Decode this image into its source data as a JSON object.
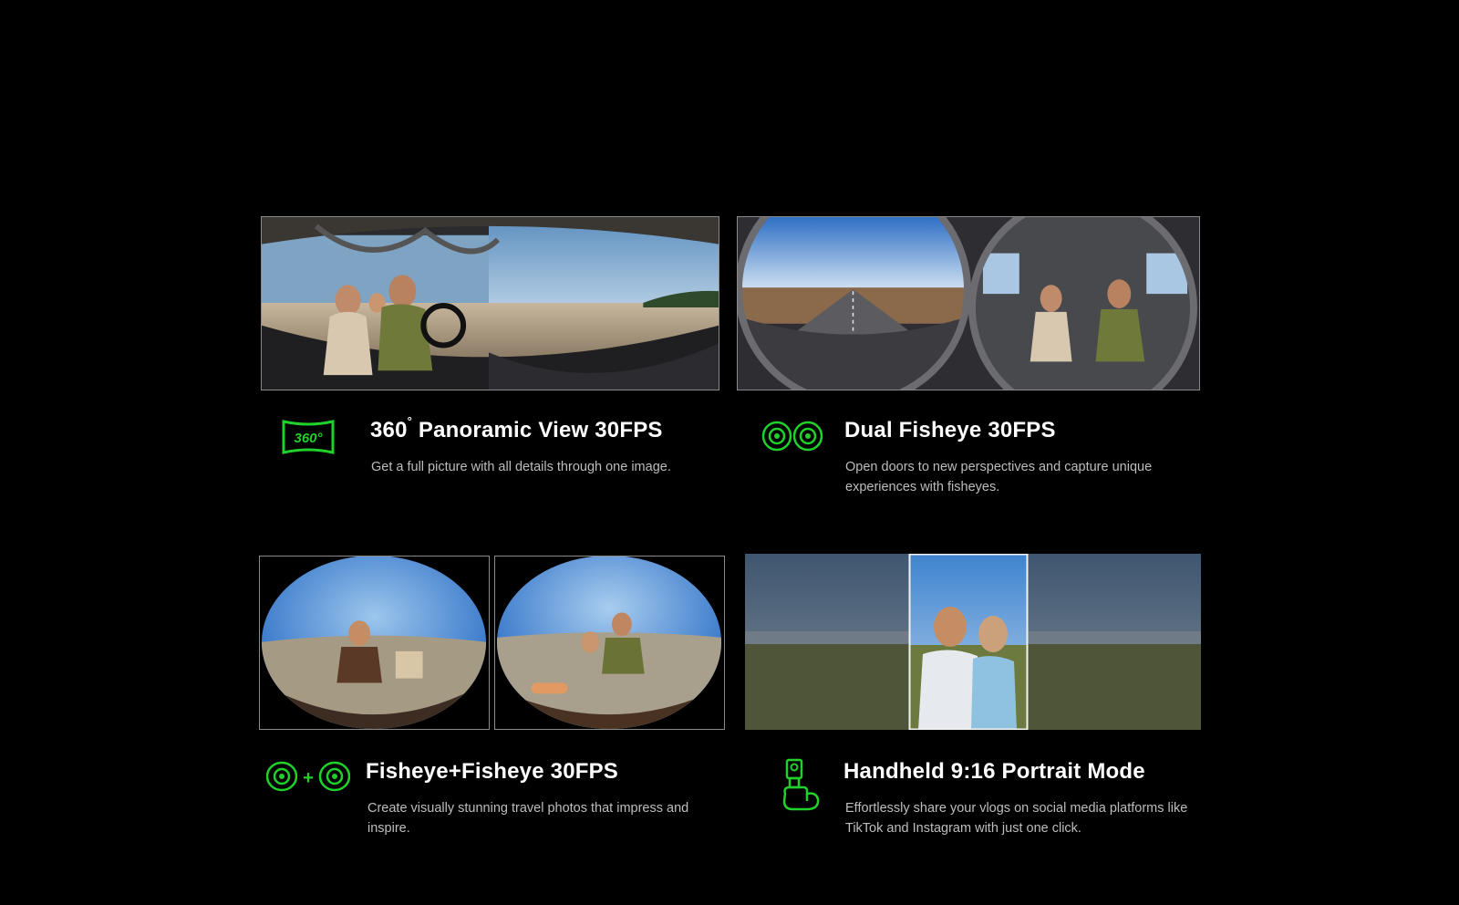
{
  "features": [
    {
      "id": "panoramic",
      "title_main": "360",
      "title_degree": "°",
      "title_rest": " Panoramic View 30FPS",
      "description": "Get a full picture with all details through one image.",
      "icon": "360-badge-icon",
      "icon_text": "360°"
    },
    {
      "id": "dual-fisheye",
      "title": "Dual Fisheye 30FPS",
      "description": "Open doors to new perspectives and capture unique experiences with fisheyes.",
      "icon": "dual-fisheye-icon"
    },
    {
      "id": "fisheye-plus",
      "title": "Fisheye+Fisheye 30FPS",
      "description": "Create visually stunning travel photos that impress and inspire.",
      "icon": "fisheye-plus-fisheye-icon",
      "icon_plus": "+"
    },
    {
      "id": "portrait",
      "title": "Handheld 9:16 Portrait Mode",
      "description": "Effortlessly share your vlogs on social media platforms like TikTok and Instagram with just one click.",
      "icon": "handheld-camera-icon"
    }
  ],
  "colors": {
    "background": "#000000",
    "accent": "#1fd12a",
    "title": "#ffffff",
    "description": "#bdbdbd"
  }
}
